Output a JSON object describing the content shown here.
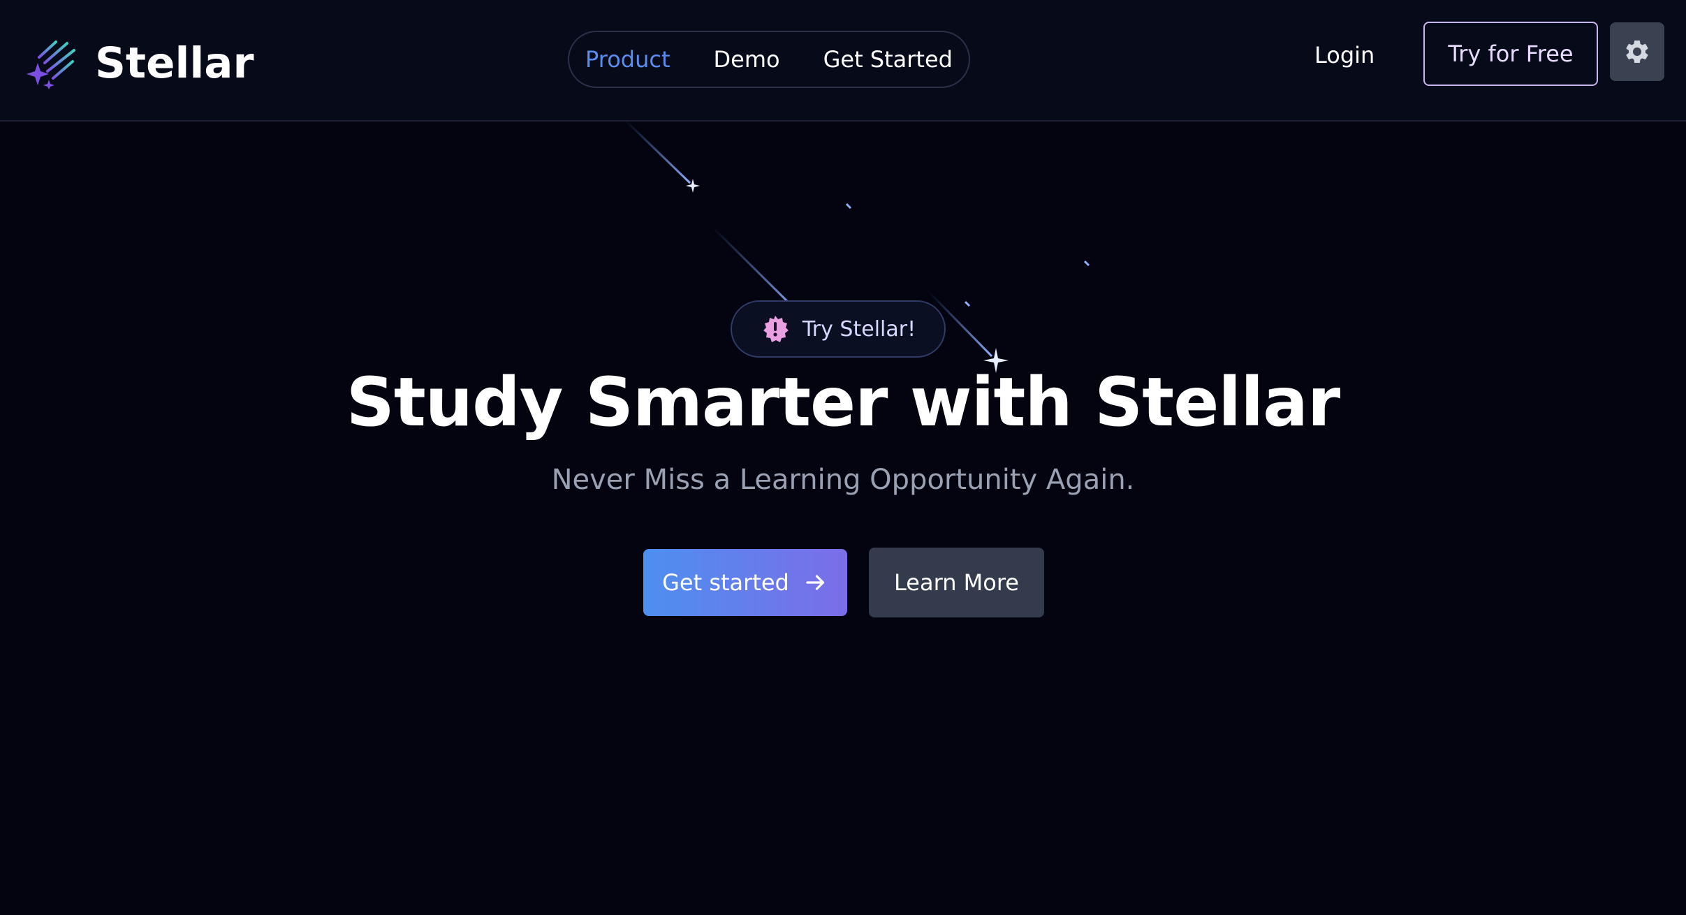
{
  "brand": {
    "name": "Stellar",
    "icon": "shooting-stars-logo"
  },
  "nav": {
    "items": [
      {
        "label": "Product",
        "active": true
      },
      {
        "label": "Demo",
        "active": false
      },
      {
        "label": "Get Started",
        "active": false
      }
    ]
  },
  "header": {
    "login_label": "Login",
    "try_free_label": "Try for Free",
    "settings_icon": "gear-icon"
  },
  "hero": {
    "badge_label": "Try Stellar!",
    "badge_icon": "alert-badge-icon",
    "title": "Study Smarter with Stellar",
    "subtitle": "Never Miss a Learning Opportunity Again.",
    "primary_button_label": "Get started",
    "primary_button_icon": "arrow-right-icon",
    "secondary_button_label": "Learn More"
  },
  "colors": {
    "background": "#03040f",
    "navbar": "#070a18",
    "active_nav": "#5b8def",
    "gradient_start": "#4d8fef",
    "gradient_end": "#7c6de8",
    "badge_icon": "#e8a0e0"
  }
}
